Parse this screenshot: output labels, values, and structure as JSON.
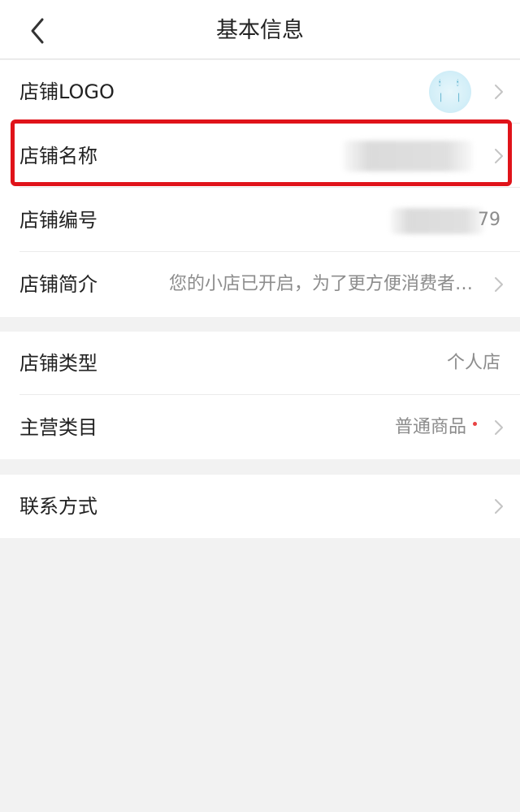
{
  "header": {
    "title": "基本信息",
    "back_icon": "chevron-left-icon"
  },
  "groups": [
    {
      "rows": [
        {
          "label": "店铺LOGO",
          "value": "",
          "has_chevron": true,
          "logo": true
        },
        {
          "label": "店铺名称",
          "value": "",
          "has_chevron": true,
          "redacted": true,
          "highlighted": true
        },
        {
          "label": "店铺编号",
          "value": "79",
          "has_chevron": false,
          "redacted": true
        },
        {
          "label": "店铺简介",
          "value": "您的小店已开启，为了更方便消费者…",
          "has_chevron": true
        }
      ]
    },
    {
      "rows": [
        {
          "label": "店铺类型",
          "value": "个人店",
          "has_chevron": false
        },
        {
          "label": "主营类目",
          "value": "普通商品",
          "has_chevron": true,
          "badge_dot": true
        }
      ]
    },
    {
      "rows": [
        {
          "label": "联系方式",
          "value": "",
          "has_chevron": true
        }
      ]
    }
  ],
  "colors": {
    "highlight_border": "#e0131a",
    "badge_dot": "#e84343",
    "page_background": "#f2f2f2"
  }
}
